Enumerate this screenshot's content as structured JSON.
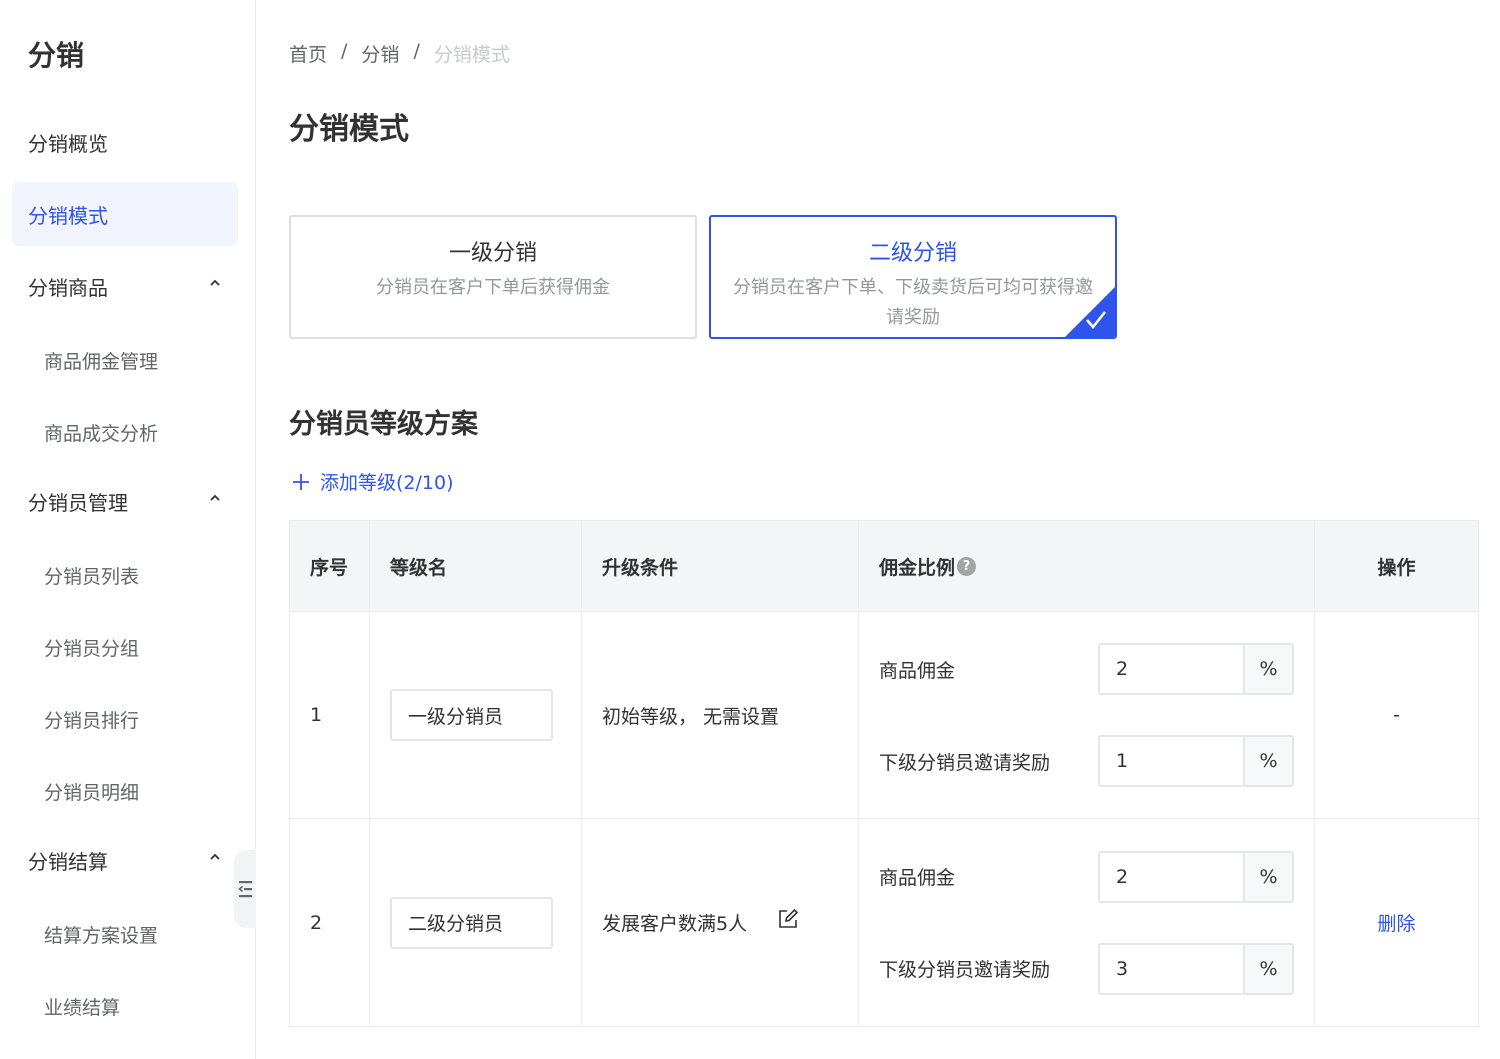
{
  "sidebar": {
    "title": "分销",
    "items": {
      "overview": "分销概览",
      "mode": "分销模式",
      "goods": "分销商品",
      "goods_commission": "商品佣金管理",
      "goods_analysis": "商品成交分析",
      "distributor_mgmt": "分销员管理",
      "distributor_list": "分销员列表",
      "distributor_group": "分销员分组",
      "distributor_rank": "分销员排行",
      "distributor_detail": "分销员明细",
      "settlement": "分销结算",
      "settlement_plan": "结算方案设置",
      "performance_settle": "业绩结算"
    },
    "active": "分销模式"
  },
  "breadcrumb": {
    "home": "首页",
    "level1": "分销",
    "current": "分销模式",
    "separator": "/"
  },
  "page_title": "分销模式",
  "modes": {
    "level1": {
      "title": "一级分销",
      "desc": "分销员在客户下单后获得佣金"
    },
    "level2": {
      "title": "二级分销",
      "desc": "分销员在客户下单、下级卖货后可均可获得邀请奖励",
      "selected": true
    }
  },
  "section_title": "分销员等级方案",
  "add_level": {
    "icon": "plus-icon",
    "label": "添加等级(2/10)"
  },
  "table": {
    "headers": {
      "index": "序号",
      "name": "等级名",
      "condition": "升级条件",
      "commission": "佣金比例",
      "action": "操作"
    },
    "rows": [
      {
        "index": "1",
        "name": "一级分销员",
        "condition": "初始等级， 无需设置",
        "goods_label": "商品佣金",
        "goods_value": "2",
        "invite_label": "下级分销员邀请奖励",
        "invite_value": "1",
        "action": "-"
      },
      {
        "index": "2",
        "name": "二级分销员",
        "condition": "发展客户数满5人",
        "goods_label": "商品佣金",
        "goods_value": "2",
        "invite_label": "下级分销员邀请奖励",
        "invite_value": "3",
        "action": "删除"
      }
    ],
    "pct_suffix": "%"
  },
  "colors": {
    "accent": "#2f54eb",
    "active_bg": "#f2f5fd",
    "header_bg": "#f4f5f7"
  }
}
